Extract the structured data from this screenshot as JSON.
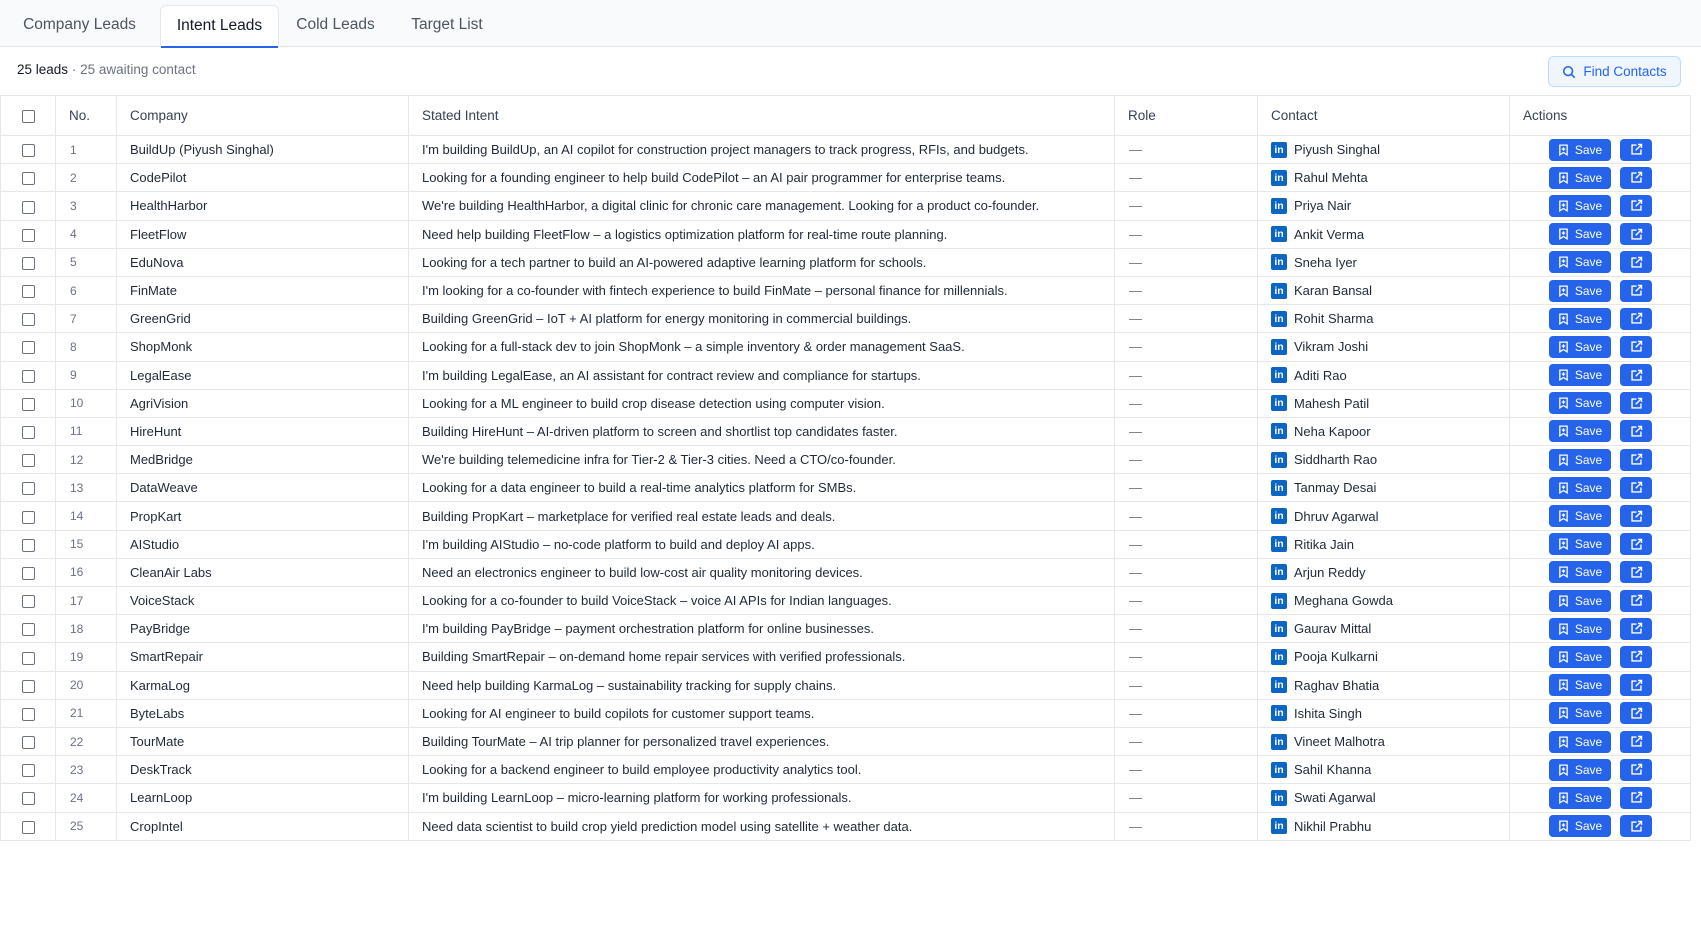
{
  "tabs": [
    {
      "label": "Company Leads",
      "active": false
    },
    {
      "label": "Intent Leads",
      "active": true
    },
    {
      "label": "Cold Leads",
      "active": false
    },
    {
      "label": "Target List",
      "active": false
    }
  ],
  "summary": {
    "count": "25 leads",
    "separator": "·",
    "awaiting": "25 awaiting contact"
  },
  "find_contacts_label": "Find Contacts",
  "table": {
    "headers": {
      "no": "No.",
      "company": "Company",
      "intent": "Stated Intent",
      "role": "Role",
      "contact": "Contact",
      "actions": "Actions"
    },
    "save_label": "Save",
    "rows": [
      {
        "no": "1",
        "company": "BuildUp (Piyush Singhal)",
        "intent": "I'm building BuildUp, an AI copilot for construction project managers to track progress, RFIs, and budgets.",
        "role": "—",
        "contact": "Piyush Singhal"
      },
      {
        "no": "2",
        "company": "CodePilot",
        "intent": "Looking for a founding engineer to help build CodePilot – an AI pair programmer for enterprise teams.",
        "role": "—",
        "contact": "Rahul Mehta"
      },
      {
        "no": "3",
        "company": "HealthHarbor",
        "intent": "We're building HealthHarbor, a digital clinic for chronic care management. Looking for a product co-founder.",
        "role": "—",
        "contact": "Priya Nair"
      },
      {
        "no": "4",
        "company": "FleetFlow",
        "intent": "Need help building FleetFlow – a logistics optimization platform for real-time route planning.",
        "role": "—",
        "contact": "Ankit Verma"
      },
      {
        "no": "5",
        "company": "EduNova",
        "intent": "Looking for a tech partner to build an AI-powered adaptive learning platform for schools.",
        "role": "—",
        "contact": "Sneha Iyer"
      },
      {
        "no": "6",
        "company": "FinMate",
        "intent": "I'm looking for a co-founder with fintech experience to build FinMate – personal finance for millennials.",
        "role": "—",
        "contact": "Karan Bansal"
      },
      {
        "no": "7",
        "company": "GreenGrid",
        "intent": "Building GreenGrid – IoT + AI platform for energy monitoring in commercial buildings.",
        "role": "—",
        "contact": "Rohit Sharma"
      },
      {
        "no": "8",
        "company": "ShopMonk",
        "intent": "Looking for a full-stack dev to join ShopMonk – a simple inventory & order management SaaS.",
        "role": "—",
        "contact": "Vikram Joshi"
      },
      {
        "no": "9",
        "company": "LegalEase",
        "intent": "I'm building LegalEase, an AI assistant for contract review and compliance for startups.",
        "role": "—",
        "contact": "Aditi Rao"
      },
      {
        "no": "10",
        "company": "AgriVision",
        "intent": "Looking for a ML engineer to build crop disease detection using computer vision.",
        "role": "—",
        "contact": "Mahesh Patil"
      },
      {
        "no": "11",
        "company": "HireHunt",
        "intent": "Building HireHunt – AI-driven platform to screen and shortlist top candidates faster.",
        "role": "—",
        "contact": "Neha Kapoor"
      },
      {
        "no": "12",
        "company": "MedBridge",
        "intent": "We're building telemedicine infra for Tier-2 & Tier-3 cities. Need a CTO/co-founder.",
        "role": "—",
        "contact": "Siddharth Rao"
      },
      {
        "no": "13",
        "company": "DataWeave",
        "intent": "Looking for a data engineer to build a real-time analytics platform for SMBs.",
        "role": "—",
        "contact": "Tanmay Desai"
      },
      {
        "no": "14",
        "company": "PropKart",
        "intent": "Building PropKart – marketplace for verified real estate leads and deals.",
        "role": "—",
        "contact": "Dhruv Agarwal"
      },
      {
        "no": "15",
        "company": "AIStudio",
        "intent": "I'm building AIStudio – no-code platform to build and deploy AI apps.",
        "role": "—",
        "contact": "Ritika Jain"
      },
      {
        "no": "16",
        "company": "CleanAir Labs",
        "intent": "Need an electronics engineer to build low-cost air quality monitoring devices.",
        "role": "—",
        "contact": "Arjun Reddy"
      },
      {
        "no": "17",
        "company": "VoiceStack",
        "intent": "Looking for a co-founder to build VoiceStack – voice AI APIs for Indian languages.",
        "role": "—",
        "contact": "Meghana Gowda"
      },
      {
        "no": "18",
        "company": "PayBridge",
        "intent": "I'm building PayBridge – payment orchestration platform for online businesses.",
        "role": "—",
        "contact": "Gaurav Mittal"
      },
      {
        "no": "19",
        "company": "SmartRepair",
        "intent": "Building SmartRepair – on-demand home repair services with verified professionals.",
        "role": "—",
        "contact": "Pooja Kulkarni"
      },
      {
        "no": "20",
        "company": "KarmaLog",
        "intent": "Need help building KarmaLog – sustainability tracking for supply chains.",
        "role": "—",
        "contact": "Raghav Bhatia"
      },
      {
        "no": "21",
        "company": "ByteLabs",
        "intent": "Looking for AI engineer to build copilots for customer support teams.",
        "role": "—",
        "contact": "Ishita Singh"
      },
      {
        "no": "22",
        "company": "TourMate",
        "intent": "Building TourMate – AI trip planner for personalized travel experiences.",
        "role": "—",
        "contact": "Vineet Malhotra"
      },
      {
        "no": "23",
        "company": "DeskTrack",
        "intent": "Looking for a backend engineer to build employee productivity analytics tool.",
        "role": "—",
        "contact": "Sahil Khanna"
      },
      {
        "no": "24",
        "company": "LearnLoop",
        "intent": "I'm building LearnLoop – micro-learning platform for working professionals.",
        "role": "—",
        "contact": "Swati Agarwal"
      },
      {
        "no": "25",
        "company": "CropIntel",
        "intent": "Need data scientist to build crop yield prediction model using satellite + weather data.",
        "role": "—",
        "contact": "Nikhil Prabhu"
      }
    ]
  },
  "icons": {
    "search": "search-icon",
    "linkedin": "linkedin-icon",
    "save": "bookmark-plus-icon",
    "external": "external-link-icon"
  },
  "colors": {
    "accent": "#2563eb",
    "linkedin": "#0a66c2",
    "border": "#e5e7eb"
  }
}
